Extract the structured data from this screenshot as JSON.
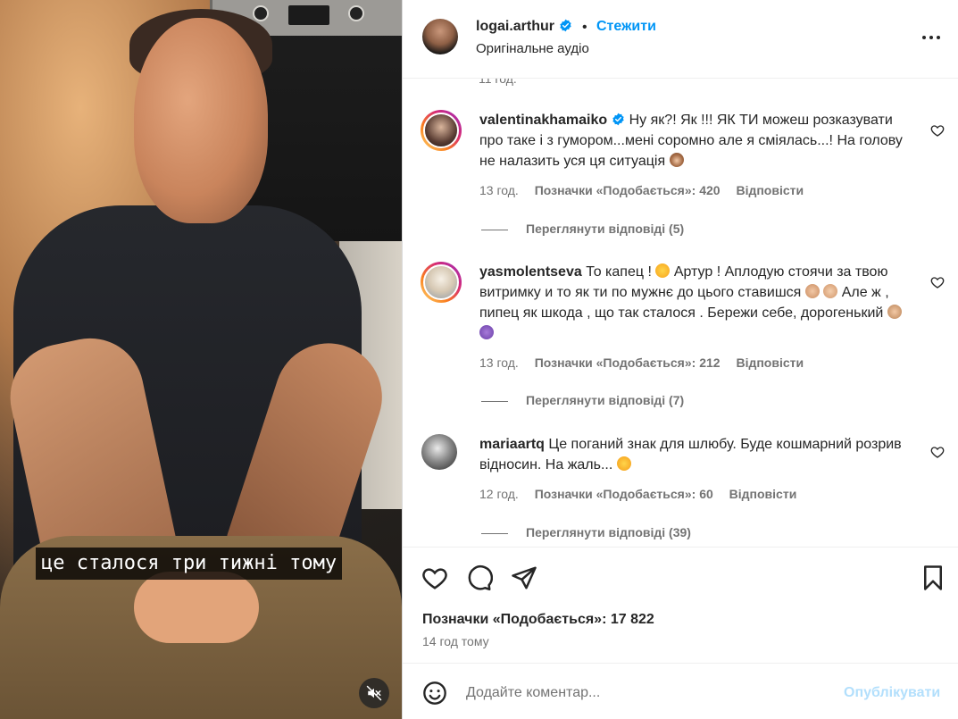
{
  "video": {
    "caption": "це сталося три тижні тому",
    "mute_icon": "speaker-muted-icon"
  },
  "post": {
    "author": "logai.arthur",
    "separator": "•",
    "follow_label": "Стежити",
    "audio_label": "Оригінальне аудіо",
    "more_icon": "more-horizontal-icon"
  },
  "clipped_time": "11 год.",
  "comments": [
    {
      "username": "valentinakhamaiko",
      "verified": true,
      "text": "Ну як?! Як !!! ЯК ТИ можеш розказувати про таке і з гумором...мені соромно але я сміялась...! На голову не налазить уся ця ситуація",
      "emojis": [
        "see-no-evil-monkey"
      ],
      "time": "13 год.",
      "likes": "Позначки «Подобається»: 420",
      "reply_label": "Відповісти",
      "view_replies": "Переглянути відповіді (5)"
    },
    {
      "username": "yasmolentseva",
      "verified": false,
      "text_a": "То капец !",
      "text_b": "Артур ! Аплодую стоячи за твою витримку и то як ти по мужнє до цього ставишся",
      "text_c": "Але ж , пипец як шкода , що так сталося . Бережи себе, дорогенький",
      "emojis": [
        "face-screaming",
        "clapping-hands",
        "flexed-biceps",
        "folded-hands",
        "purple-heart"
      ],
      "time": "13 год.",
      "likes": "Позначки «Подобається»: 212",
      "reply_label": "Відповісти",
      "view_replies": "Переглянути відповіді (7)"
    },
    {
      "username": "mariaartq",
      "verified": false,
      "text": "Це поганий знак для шлюбу. Буде кошмарний розрив відносин. На жаль...",
      "emojis": [
        "flushed-face"
      ],
      "time": "12 год.",
      "likes": "Позначки «Подобається»: 60",
      "reply_label": "Відповісти",
      "view_replies": "Переглянути відповіді (39)"
    }
  ],
  "actions": {
    "like_icon": "heart-icon",
    "comment_icon": "comment-icon",
    "share_icon": "paper-plane-icon",
    "save_icon": "bookmark-icon",
    "likes_text": "Позначки «Подобається»: 17 822",
    "post_time": "14 год тому"
  },
  "composer": {
    "emoji_icon": "smiley-icon",
    "placeholder": "Додайте коментар...",
    "publish_label": "Опублікувати"
  },
  "colors": {
    "accent": "#0095f6",
    "publish_disabled": "#b2dffc",
    "secondary_text": "#737373",
    "verified": "#0095f6"
  }
}
